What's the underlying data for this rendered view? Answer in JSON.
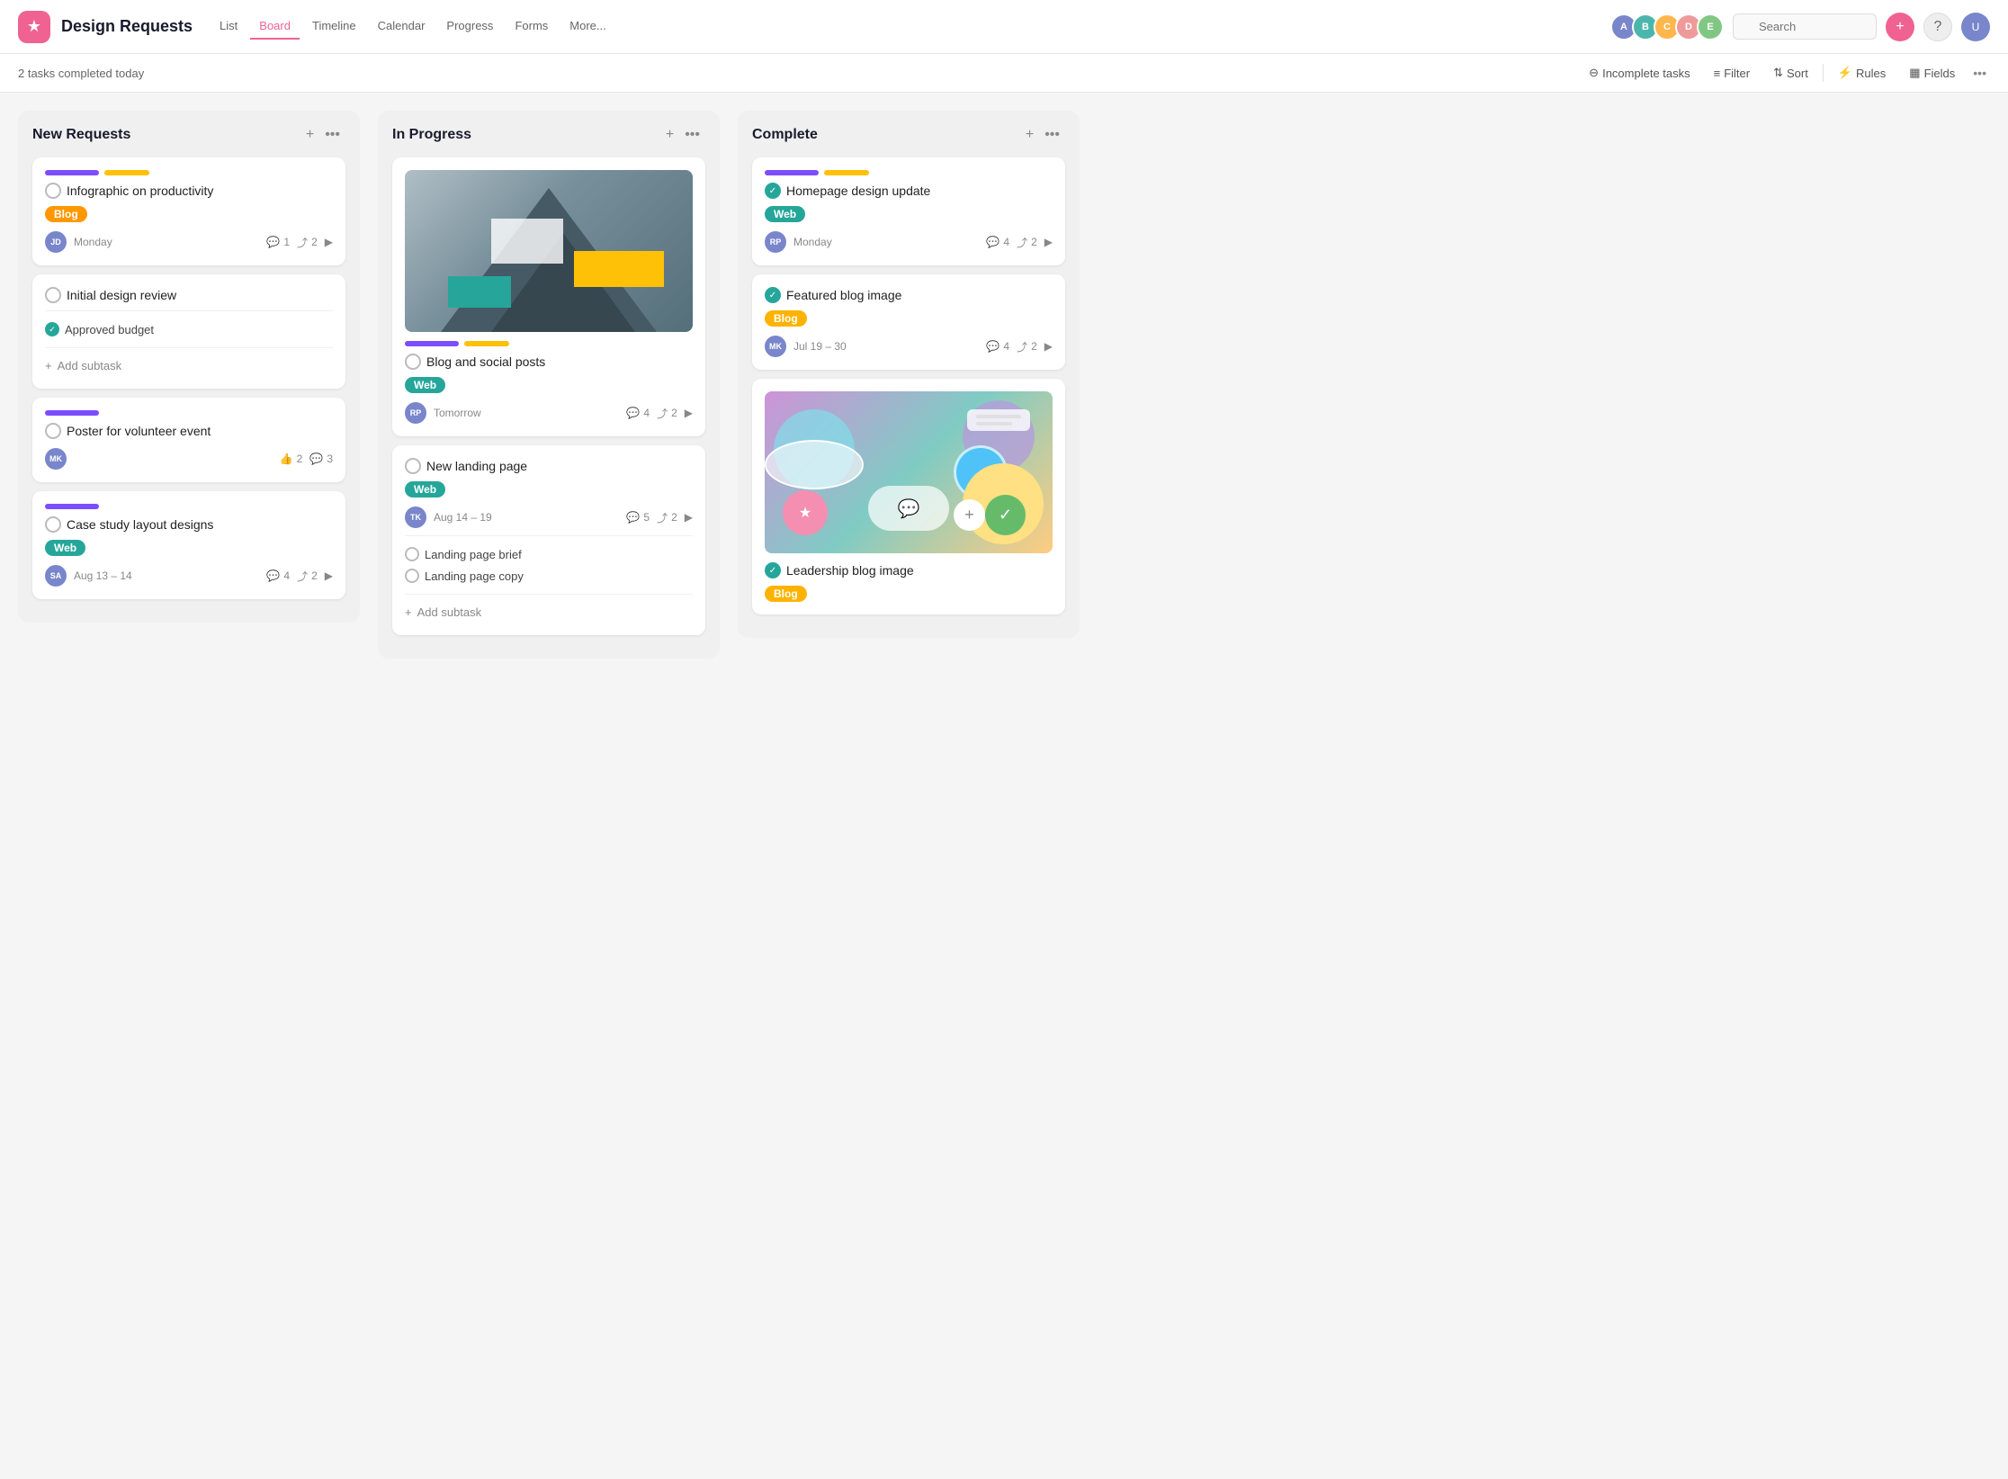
{
  "app": {
    "icon": "★",
    "title": "Design Requests"
  },
  "nav": {
    "tabs": [
      {
        "id": "list",
        "label": "List",
        "active": false
      },
      {
        "id": "board",
        "label": "Board",
        "active": true
      },
      {
        "id": "timeline",
        "label": "Timeline",
        "active": false
      },
      {
        "id": "calendar",
        "label": "Calendar",
        "active": false
      },
      {
        "id": "progress",
        "label": "Progress",
        "active": false
      },
      {
        "id": "forms",
        "label": "Forms",
        "active": false
      },
      {
        "id": "more",
        "label": "More...",
        "active": false
      }
    ]
  },
  "toolbar": {
    "tasks_completed": "2 tasks completed today",
    "incomplete_tasks_label": "Incomplete tasks",
    "filter_label": "Filter",
    "sort_label": "Sort",
    "rules_label": "Rules",
    "fields_label": "Fields"
  },
  "columns": [
    {
      "id": "new-requests",
      "title": "New Requests",
      "cards": [
        {
          "id": "card-1",
          "tags": [
            "purple",
            "yellow"
          ],
          "title": "Infographic on productivity",
          "badge": "Blog",
          "badge_type": "orange",
          "assignee_initials": "JD",
          "assignee_color": "brown",
          "date": "Monday",
          "comments": "1",
          "subtasks": "2",
          "has_arrow": true
        },
        {
          "id": "card-2",
          "title": "Initial design review",
          "subtasks": [
            {
              "text": "Approved budget",
              "done": true
            }
          ],
          "add_subtask": "Add subtask"
        },
        {
          "id": "card-3",
          "tags": [
            "purple"
          ],
          "title": "Poster for volunteer event",
          "assignee_initials": "MK",
          "assignee_color": "brown",
          "likes": "2",
          "comments": "3"
        },
        {
          "id": "card-4",
          "tags": [
            "purple"
          ],
          "title": "Case study layout designs",
          "badge": "Web",
          "badge_type": "teal",
          "assignee_initials": "SA",
          "assignee_color": "pink",
          "date": "Aug 13 – 14",
          "comments": "4",
          "subtasks_count": "2",
          "has_arrow": true
        }
      ]
    },
    {
      "id": "in-progress",
      "title": "In Progress",
      "cards": [
        {
          "id": "card-5",
          "has_image": true,
          "image_type": "mountain",
          "tags": [
            "purple",
            "yellow"
          ],
          "title": "Blog and social posts",
          "badge": "Web",
          "badge_type": "teal",
          "assignee_initials": "RP",
          "assignee_color": "pink",
          "date": "Tomorrow",
          "comments": "4",
          "subtasks_count": "2",
          "has_arrow": true
        },
        {
          "id": "card-6",
          "title": "New landing page",
          "badge": "Web",
          "badge_type": "teal",
          "assignee_initials": "TK",
          "assignee_color": "blue",
          "date": "Aug 14 – 19",
          "comments": "5",
          "subtasks_count": "2",
          "has_arrow": true,
          "subtasks": [
            {
              "text": "Landing page brief",
              "done": false
            },
            {
              "text": "Landing page copy",
              "done": false
            }
          ],
          "add_subtask": "Add subtask"
        }
      ]
    },
    {
      "id": "complete",
      "title": "Complete",
      "cards": [
        {
          "id": "card-7",
          "tags": [
            "purple",
            "yellow"
          ],
          "title": "Homepage design update",
          "badge": "Web",
          "badge_type": "teal",
          "completed": true,
          "assignee_initials": "RP",
          "assignee_color": "pink",
          "date": "Monday",
          "comments": "4",
          "subtasks_count": "2",
          "has_arrow": true
        },
        {
          "id": "card-8",
          "title": "Featured blog image",
          "badge": "Blog",
          "badge_type": "blog",
          "completed": true,
          "assignee_initials": "MK",
          "assignee_color": "brown",
          "date": "Jul 19 – 30",
          "comments": "4",
          "subtasks_count": "2",
          "has_arrow": true
        },
        {
          "id": "card-9",
          "has_image": true,
          "image_type": "shapes",
          "title": "Leadership blog image",
          "badge": "Blog",
          "badge_type": "blog",
          "completed": true
        }
      ]
    }
  ]
}
